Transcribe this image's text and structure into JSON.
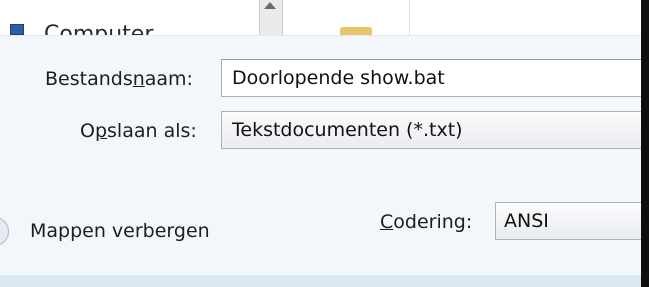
{
  "top_strip": {
    "computer_label": "Computer"
  },
  "form": {
    "filename_label_pre": "Bestands",
    "filename_label_mnemonic": "n",
    "filename_label_post": "aam:",
    "filename_value": "Doorlopende show.bat",
    "saveas_label_pre": "O",
    "saveas_label_mnemonic": "p",
    "saveas_label_post": "slaan als:",
    "saveas_value": "Tekstdocumenten (*.txt)",
    "encoding_label_mnemonic": "C",
    "encoding_label_post": "odering:",
    "encoding_value": "ANSI"
  },
  "footer": {
    "hide_folders_label": "Mappen verbergen"
  }
}
